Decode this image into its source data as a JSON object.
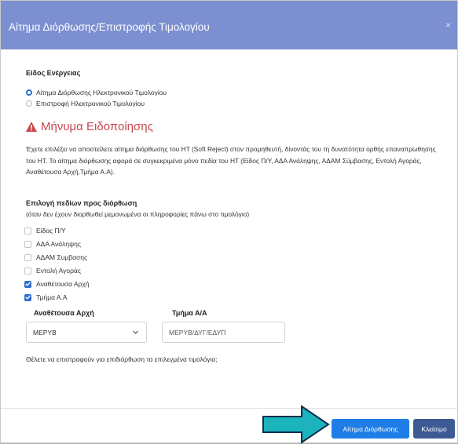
{
  "modal": {
    "title": "Αίτημα Διόρθωσης/Επιστροφής Τιμολογίου",
    "close_label": "×"
  },
  "action_type": {
    "label": "Είδος Ενέργειας",
    "options": [
      {
        "label": "Αίτημα Διόρθωσης Ηλεκτρονικού Τιμολογίου",
        "selected": true
      },
      {
        "label": "Επιστροφή Ηλεκτρονικού Τιμολογίου",
        "selected": false
      }
    ]
  },
  "notice": {
    "title": "Μήνυμα Ειδοποίησης",
    "text": "Έχετε επιλέξει να αποστείλετε αίτημα διόρθωσης του ΗΤ (Soft Reject) στον προμηθευτή, δίνοντάς του τη δυνατότητα ορθής επαναπρωθησης του ΗΤ. Το αίτημα διόρθωσης αφορά σε συγκεκριμένα μόνο πεδία του ΗΤ (Είδος Π/Υ, ΑΔΑ Ανάληψης, ΑΔΑΜ Σύμβασης, Εντολή Αγοράς, Αναθέτουσα Αρχή,Τμήμα Α.Α)."
  },
  "fields_selection": {
    "label": "Επιλογή πεδίων προς διόρθωση",
    "hint": "(όταν δεν έχουν διορθωθεί μεμονωμένα οι πληροφορίες πάνω στο τιμολόγιο)",
    "items": [
      {
        "label": "Είδος Π/Υ",
        "checked": false
      },
      {
        "label": "ΑΔΑ Ανάληψης",
        "checked": false
      },
      {
        "label": "ΑΔΑΜ Συμβασης",
        "checked": false
      },
      {
        "label": "Εντολή Αγοράς",
        "checked": false
      },
      {
        "label": "Αναθέτουσα Αρχή",
        "checked": true
      },
      {
        "label": "Τμήμα Α.Α",
        "checked": true
      }
    ]
  },
  "contracting_authority": {
    "label": "Αναθέτουσα Αρχή",
    "value": "ΜΕΡΥΒ"
  },
  "department": {
    "label": "Τμήμα Α/Α",
    "value": "ΜΕΡΥΒ/ΔΥΓ/ΕΔΥΠ"
  },
  "question": "Θέλετε να επιστραφούν για επιδιόρθωση τα επιλεγμένα τιμολόγια;",
  "footer": {
    "primary_button": "Αίτημα Διόρθωσης",
    "close_button": "Κλείσιμο"
  },
  "colors": {
    "header": "#7c8fd0",
    "warning": "#c8464e",
    "primary": "#1f7de6",
    "secondary": "#3e5a94",
    "arrow": "#1bb3bc"
  },
  "icons": [
    "warning-triangle-icon",
    "chevron-down-icon",
    "check-icon",
    "pointer-arrow-icon"
  ]
}
